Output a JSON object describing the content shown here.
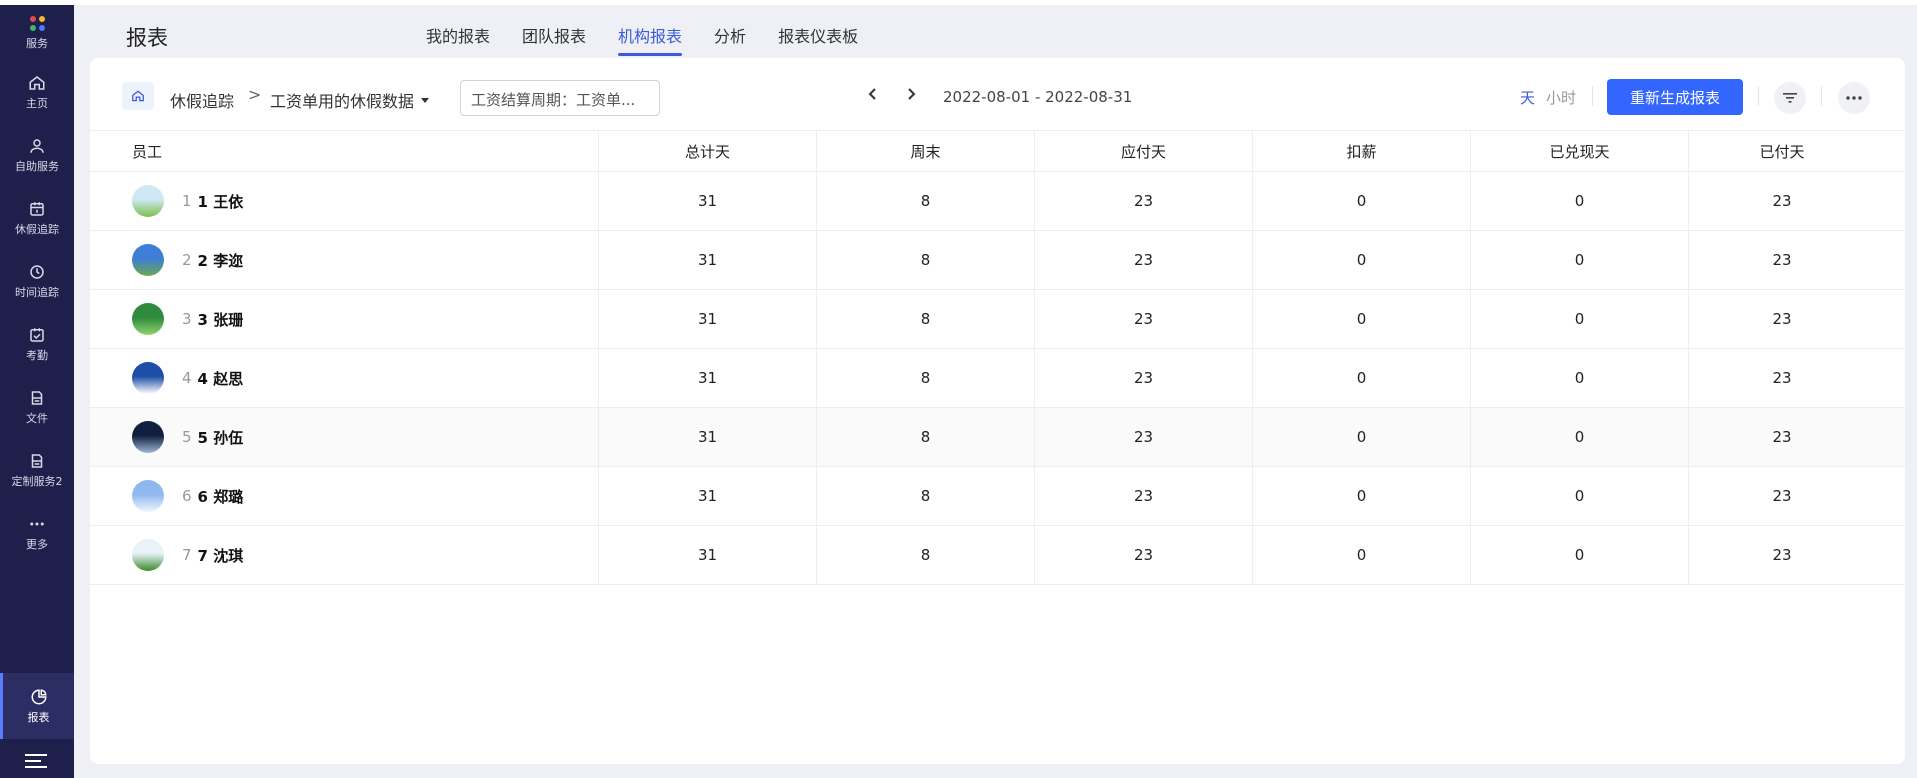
{
  "sidebar": {
    "logo_label": "服务",
    "logo_colors": [
      "#e34b4b",
      "#f5b82e",
      "#3db56b",
      "#4a7cf5"
    ],
    "items": [
      {
        "label": "主页",
        "icon": "home-icon"
      },
      {
        "label": "自助服务",
        "icon": "user-icon"
      },
      {
        "label": "休假追踪",
        "icon": "calendar-icon"
      },
      {
        "label": "时间追踪",
        "icon": "clock-icon"
      },
      {
        "label": "考勤",
        "icon": "calendar-check-icon"
      },
      {
        "label": "文件",
        "icon": "file-icon"
      },
      {
        "label": "定制服务2",
        "icon": "file-icon"
      },
      {
        "label": "更多",
        "icon": "more-icon"
      }
    ],
    "active_item": {
      "label": "报表",
      "icon": "pie-chart-icon"
    }
  },
  "header": {
    "title": "报表",
    "tabs": [
      {
        "label": "我的报表"
      },
      {
        "label": "团队报表"
      },
      {
        "label": "机构报表"
      },
      {
        "label": "分析"
      },
      {
        "label": "报表仪表板"
      }
    ],
    "active_tab": "机构报表"
  },
  "toolbar": {
    "breadcrumb_root": "休假追踪",
    "breadcrumb_sep": ">",
    "report_name": "工资单用的休假数据",
    "period_value": "工资结算周期：工资单...",
    "date_range": "2022-08-01 - 2022-08-31",
    "unit_day": "天",
    "unit_hour": "小时",
    "regen_label": "重新生成报表"
  },
  "table": {
    "columns": [
      "员工",
      "总计天",
      "周末",
      "应付天",
      "扣薪",
      "已兑现天",
      "已付天"
    ],
    "rows": [
      {
        "idx": "1",
        "name": "1 王依",
        "total": "31",
        "weekend": "8",
        "payable": "23",
        "deduct": "0",
        "cashed": "0",
        "paid": "23",
        "avatar": [
          "#cfe8f5",
          "#7bbf4a"
        ]
      },
      {
        "idx": "2",
        "name": "2 李迩",
        "total": "31",
        "weekend": "8",
        "payable": "23",
        "deduct": "0",
        "cashed": "0",
        "paid": "23",
        "avatar": [
          "#3d7fd6",
          "#6aa84f"
        ]
      },
      {
        "idx": "3",
        "name": "3 张珊",
        "total": "31",
        "weekend": "8",
        "payable": "23",
        "deduct": "0",
        "cashed": "0",
        "paid": "23",
        "avatar": [
          "#2f8a3e",
          "#8fd36a"
        ]
      },
      {
        "idx": "4",
        "name": "4 赵思",
        "total": "31",
        "weekend": "8",
        "payable": "23",
        "deduct": "0",
        "cashed": "0",
        "paid": "23",
        "avatar": [
          "#1d4fa8",
          "#ffffff"
        ]
      },
      {
        "idx": "5",
        "name": "5 孙伍",
        "total": "31",
        "weekend": "8",
        "payable": "23",
        "deduct": "0",
        "cashed": "0",
        "paid": "23",
        "avatar": [
          "#0f1f3d",
          "#9fb6d6"
        ]
      },
      {
        "idx": "6",
        "name": "6 郑璐",
        "total": "31",
        "weekend": "8",
        "payable": "23",
        "deduct": "0",
        "cashed": "0",
        "paid": "23",
        "avatar": [
          "#8fb8ee",
          "#f0f6ff"
        ]
      },
      {
        "idx": "7",
        "name": "7 沈琪",
        "total": "31",
        "weekend": "8",
        "payable": "23",
        "deduct": "0",
        "cashed": "0",
        "paid": "23",
        "avatar": [
          "#e8f2f8",
          "#3a8a2a"
        ]
      }
    ],
    "highlighted_row": 4
  },
  "colors": {
    "accent": "#3366ff",
    "sidebar_bg": "#1e1f4b",
    "active_tab": "#3b5bdb"
  }
}
